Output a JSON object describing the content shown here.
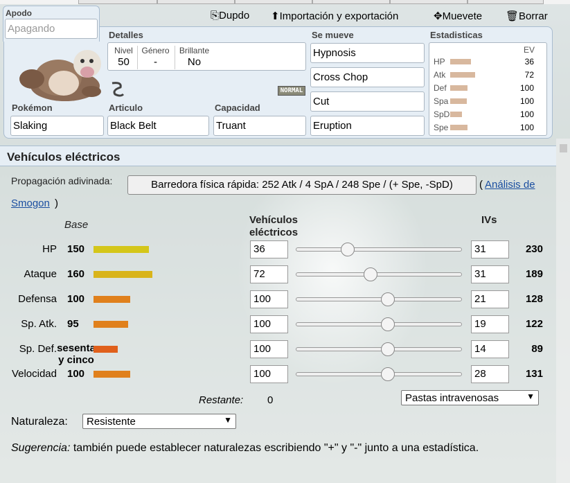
{
  "set": {
    "nickname": {
      "label": "Apodo",
      "placeholder": "Apagando"
    },
    "toolbar": {
      "copy": "Dupdo",
      "import_export": "Importación y exportación",
      "move": "Muevete",
      "delete": "Borrar"
    },
    "details": {
      "label": "Detalles",
      "level_label": "Nivel",
      "level": "50",
      "gender_label": "Género",
      "gender": "-",
      "shiny_label": "Brillante",
      "shiny": "No"
    },
    "type_badge": "NORMAL",
    "pokemon": {
      "label": "Pokémon",
      "value": "Slaking"
    },
    "item": {
      "label": "Articulo",
      "value": "Black Belt"
    },
    "ability": {
      "label": "Capacidad",
      "value": "Truant"
    },
    "moves": {
      "label": "Se mueve",
      "list": [
        "Hypnosis",
        "Cross Chop",
        "Cut",
        "Eruption"
      ]
    },
    "stats": {
      "label": "Estadisticas",
      "ev_header": "EV",
      "rows": [
        {
          "name": "HP",
          "ev": "36",
          "bar": 0.3
        },
        {
          "name": "Atk",
          "ev": "72",
          "bar": 0.36
        },
        {
          "name": "Def",
          "ev": "100",
          "bar": 0.25
        },
        {
          "name": "Spa",
          "ev": "100",
          "bar": 0.24
        },
        {
          "name": "SpD",
          "ev": "100",
          "bar": 0.17
        },
        {
          "name": "Spe",
          "ev": "100",
          "bar": 0.25
        }
      ]
    }
  },
  "evs_panel": {
    "title": "Vehículos eléctricos",
    "guess_label": "Propagación adivinada:",
    "guess_button": "Barredora física rápida: 252 Atk / 4 SpA / 248 Spe / (+ Spe, -SpD)",
    "open_paren": "(",
    "analysis_link_1": "Análisis de",
    "analysis_link_2": "Smogon",
    "close_paren": ")",
    "col_base": "Base",
    "col_evs": "Vehículos eléctricos",
    "col_ivs": "IVs",
    "rows": [
      {
        "label": "HP",
        "base": "150",
        "base_val": 150,
        "bar_color": "#d4c61a",
        "ev": "36",
        "ev_val": 36,
        "iv": "31",
        "total": "230"
      },
      {
        "label": "Ataque",
        "base": "160",
        "base_val": 160,
        "bar_color": "#d9b41a",
        "ev": "72",
        "ev_val": 72,
        "iv": "31",
        "total": "189"
      },
      {
        "label": "Defensa",
        "base": "100",
        "base_val": 100,
        "bar_color": "#e0801c",
        "ev": "100",
        "ev_val": 100,
        "iv": "21",
        "total": "128"
      },
      {
        "label": "Sp. Atk.",
        "base": "95",
        "base_val": 95,
        "bar_color": "#e0801c",
        "ev": "100",
        "ev_val": 100,
        "iv": "19",
        "total": "122"
      },
      {
        "label": "Sp. Def.",
        "base": "sesenta y cinco",
        "base_val": 65,
        "bar_color": "#e0601c",
        "ev": "100",
        "ev_val": 100,
        "iv": "14",
        "total": "89"
      },
      {
        "label": "Velocidad",
        "base": "100",
        "base_val": 100,
        "bar_color": "#e0801c",
        "ev": "100",
        "ev_val": 100,
        "iv": "28",
        "total": "131"
      }
    ],
    "remaining_label": "Restante:",
    "remaining_value": "0",
    "iv_preset": "Pastas intravenosas",
    "nature_label": "Naturaleza:",
    "nature_value": "Resistente",
    "hint_prefix": "Sugerencia:",
    "hint_text": "también puede establecer naturalezas escribiendo \"+\" y \"-\" junto a una estadística."
  }
}
